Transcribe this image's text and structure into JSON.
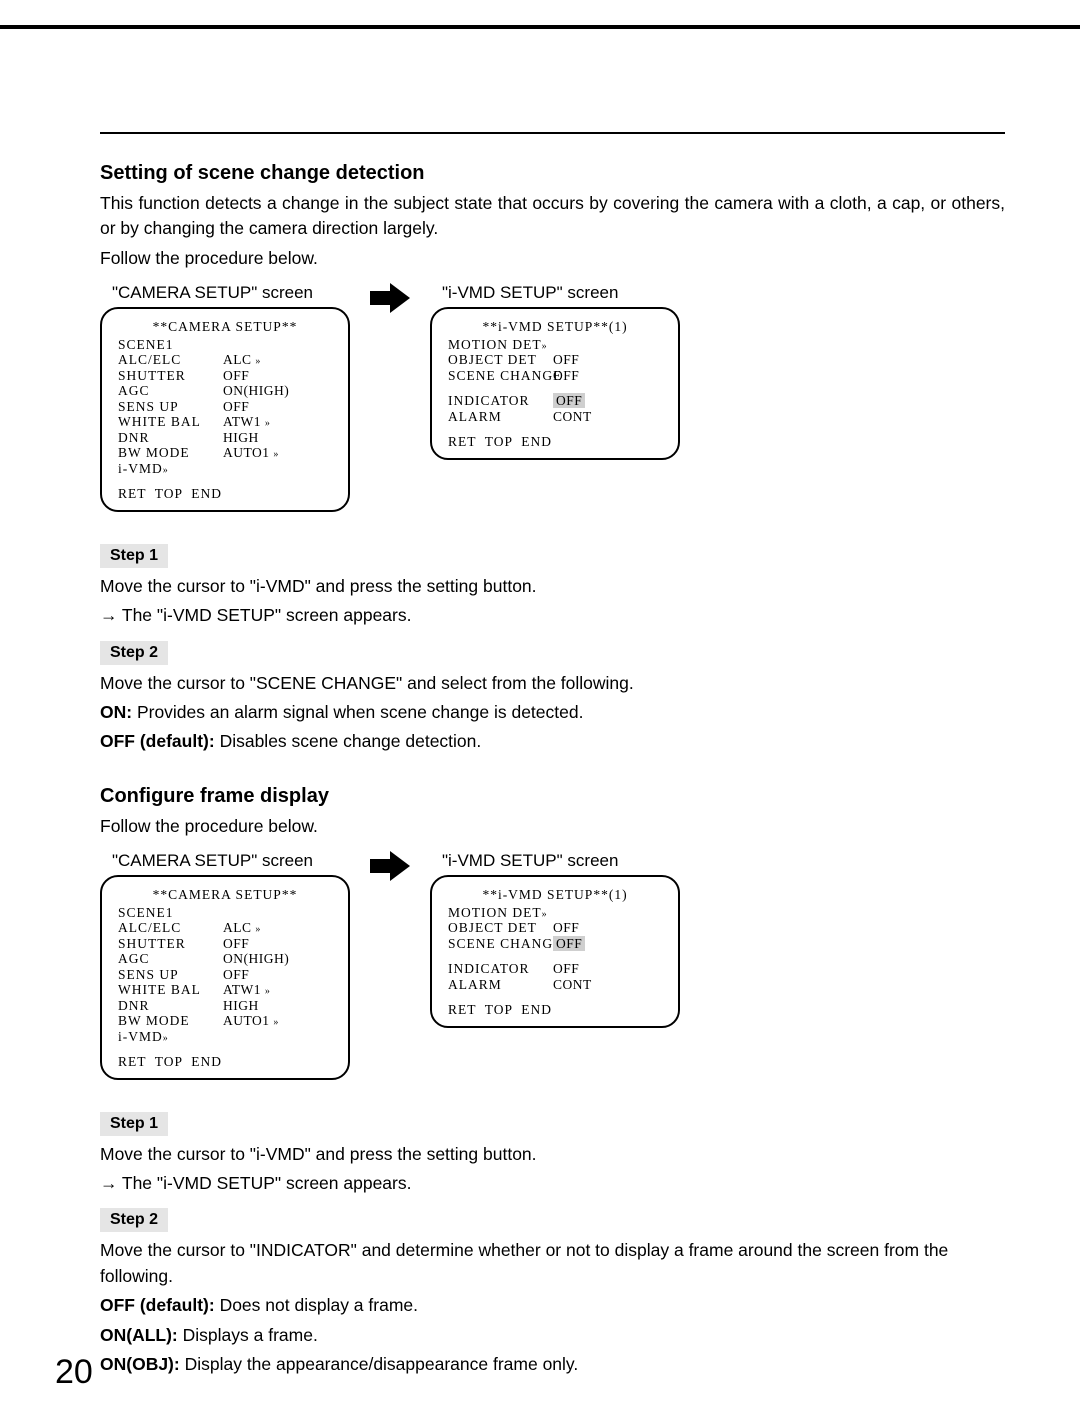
{
  "page_number": "20",
  "section1": {
    "heading": "Setting of scene change detection",
    "intro1": "This function detects a change in the subject state that occurs by covering the camera with a cloth, a cap, or others, or by changing the camera direction largely.",
    "intro2": "Follow the procedure below.",
    "screen_a_label": "\"CAMERA SETUP\" screen",
    "screen_b_label": "\"i-VMD SETUP\" screen",
    "camera_setup": {
      "title": "**CAMERA SETUP**",
      "rows": [
        {
          "k": "SCENE1",
          "v": ""
        },
        {
          "k": "ALC/ELC",
          "v": "ALC"
        },
        {
          "k": "SHUTTER",
          "v": "OFF"
        },
        {
          "k": "AGC",
          "v": "ON(HIGH)"
        },
        {
          "k": "SENS UP",
          "v": "OFF"
        },
        {
          "k": "WHITE BAL",
          "v": "ATW1"
        },
        {
          "k": "DNR",
          "v": "HIGH"
        },
        {
          "k": "BW MODE",
          "v": "AUTO1"
        },
        {
          "k": "i-VMD",
          "v": ""
        }
      ],
      "footer": "RET  TOP  END"
    },
    "ivmd_setup": {
      "title": "**i-VMD SETUP**(1)",
      "rows": [
        {
          "k": "MOTION DET",
          "v": ""
        },
        {
          "k": "OBJECT DET",
          "v": "OFF"
        },
        {
          "k": "SCENE CHANGE",
          "v": "OFF"
        },
        {
          "k": "",
          "v": ""
        },
        {
          "k": "INDICATOR",
          "v": "OFF",
          "hl": true
        },
        {
          "k": "ALARM",
          "v": "CONT"
        }
      ],
      "footer": "RET  TOP  END"
    },
    "step1_label": "Step 1",
    "step1_text": "Move the cursor to \"i-VMD\" and press the setting button.",
    "step1_result": "The \"i-VMD SETUP\" screen appears.",
    "step2_label": "Step 2",
    "step2_text": "Move the cursor to \"SCENE CHANGE\" and select from the following.",
    "step2_on_label": "ON:",
    "step2_on_text": " Provides an alarm signal when scene change is detected.",
    "step2_off_label": "OFF (default):",
    "step2_off_text": " Disables scene change detection."
  },
  "section2": {
    "heading": "Configure frame display",
    "intro1": "Follow the procedure below.",
    "screen_a_label": "\"CAMERA SETUP\" screen",
    "screen_b_label": "\"i-VMD SETUP\" screen",
    "camera_setup": {
      "title": "**CAMERA SETUP**",
      "rows": [
        {
          "k": "SCENE1",
          "v": ""
        },
        {
          "k": "ALC/ELC",
          "v": "ALC"
        },
        {
          "k": "SHUTTER",
          "v": "OFF"
        },
        {
          "k": "AGC",
          "v": "ON(HIGH)"
        },
        {
          "k": "SENS UP",
          "v": "OFF"
        },
        {
          "k": "WHITE BAL",
          "v": "ATW1"
        },
        {
          "k": "DNR",
          "v": "HIGH"
        },
        {
          "k": "BW MODE",
          "v": "AUTO1"
        },
        {
          "k": "i-VMD",
          "v": ""
        }
      ],
      "footer": "RET  TOP  END"
    },
    "ivmd_setup": {
      "title": "**i-VMD SETUP**(1)",
      "rows": [
        {
          "k": "MOTION DET",
          "v": ""
        },
        {
          "k": "OBJECT DET",
          "v": "OFF"
        },
        {
          "k": "SCENE CHANGE",
          "v": "OFF",
          "hl": true
        },
        {
          "k": "",
          "v": ""
        },
        {
          "k": "INDICATOR",
          "v": "OFF"
        },
        {
          "k": "ALARM",
          "v": "CONT"
        }
      ],
      "footer": "RET  TOP  END"
    },
    "step1_label": "Step 1",
    "step1_text": "Move the cursor to \"i-VMD\" and press the setting button.",
    "step1_result": "The \"i-VMD SETUP\" screen appears.",
    "step2_label": "Step 2",
    "step2_text": "Move the cursor to \"INDICATOR\" and determine whether or not to display a frame around the screen from the following.",
    "step2_off_label": "OFF (default):",
    "step2_off_text": " Does not display a frame.",
    "step2_onall_label": "ON(ALL):",
    "step2_onall_text": " Displays a frame.",
    "step2_onobj_label": "ON(OBJ):",
    "step2_onobj_text": " Display the appearance/disappearance frame only."
  }
}
